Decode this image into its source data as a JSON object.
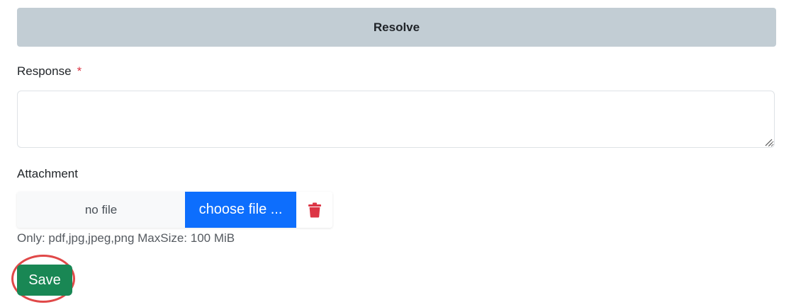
{
  "header": {
    "resolve_label": "Resolve"
  },
  "form": {
    "response_label": "Response",
    "required_mark": "*",
    "response_value": "",
    "attachment_label": "Attachment",
    "file_name": "no file",
    "choose_file_label": "choose file ...",
    "hint": "Only: pdf,jpg,jpeg,png MaxSize: 100 MiB",
    "save_label": "Save"
  },
  "icons": {
    "delete": "trash-icon",
    "resize": "resize-grip-icon"
  },
  "colors": {
    "resolve_bg": "#c2cdd4",
    "choose_file_bg": "#0d6efd",
    "save_bg": "#198754",
    "danger": "#dc3545",
    "highlight_ring": "#e04848"
  }
}
